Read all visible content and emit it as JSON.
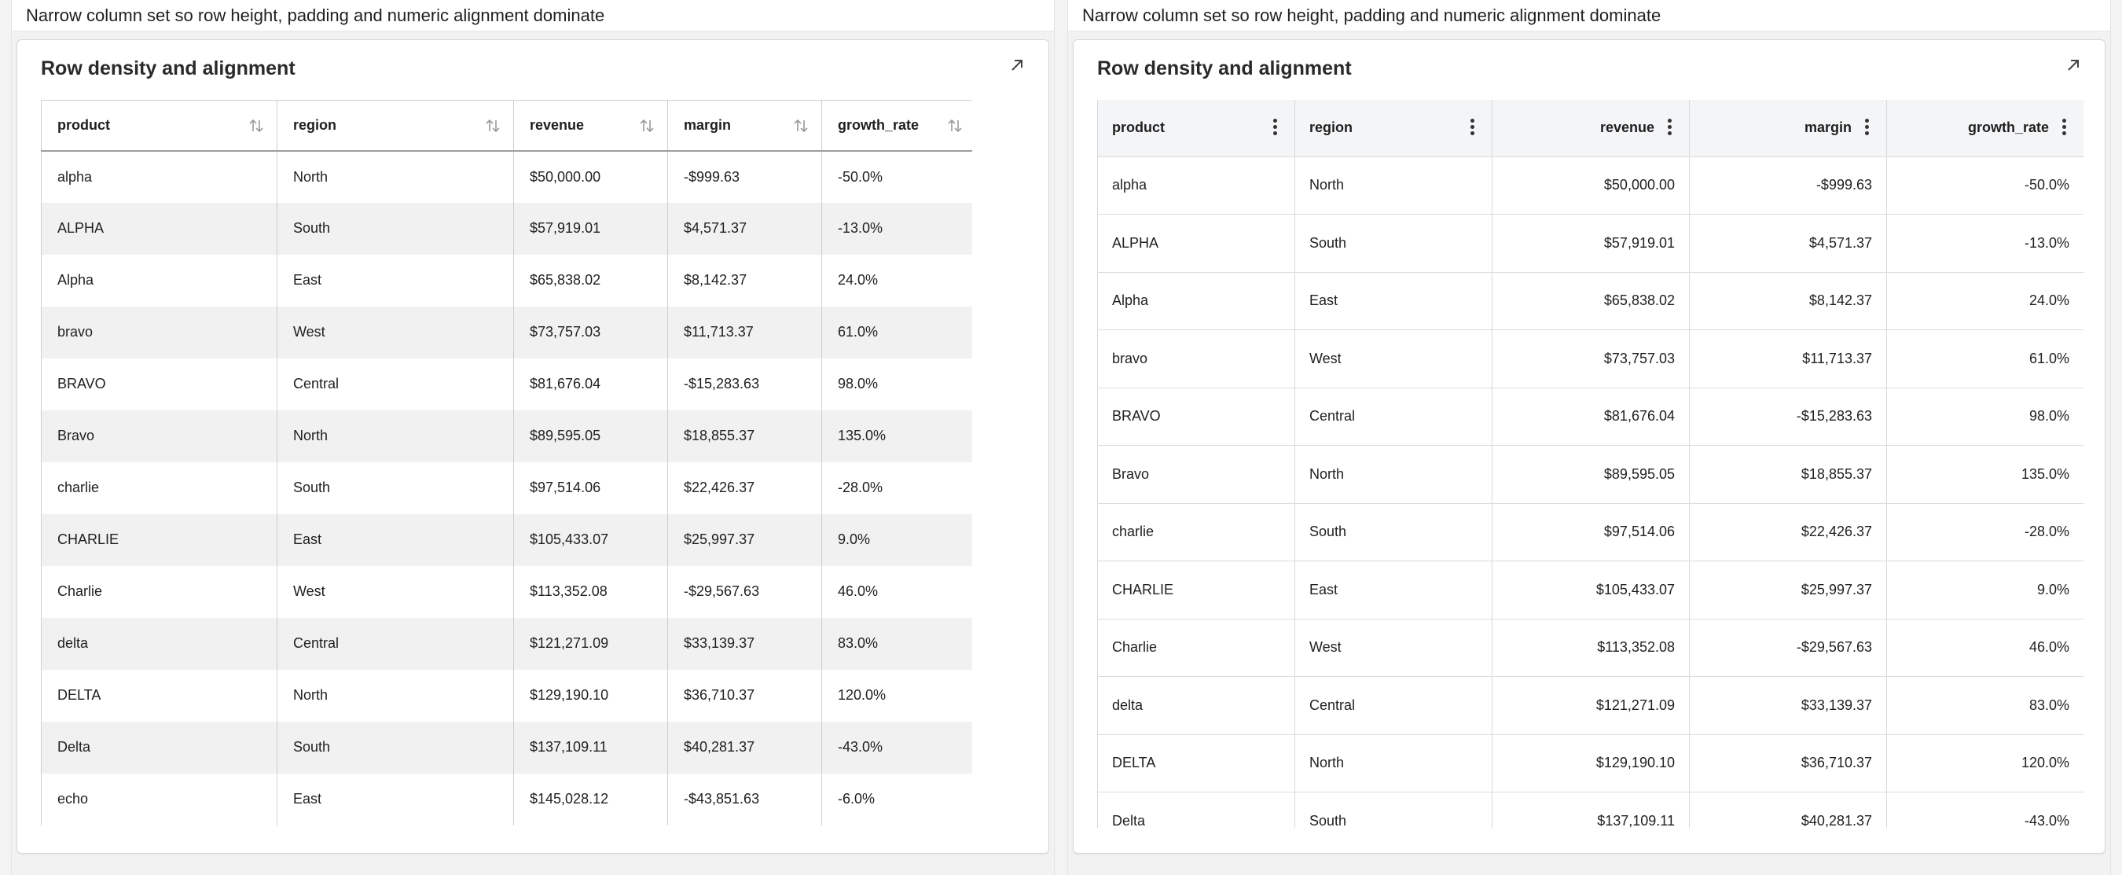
{
  "left_panel": {
    "caption": "Narrow column set so row height, padding and numeric alignment dominate",
    "card_title": "Row density and alignment",
    "columns": [
      "product",
      "region",
      "revenue",
      "margin",
      "growth_rate"
    ]
  },
  "right_panel": {
    "caption": "Narrow column set so row height, padding and numeric alignment dominate",
    "card_title": "Row density and alignment",
    "columns": [
      "product",
      "region",
      "revenue",
      "margin",
      "growth_rate"
    ]
  },
  "rows": [
    {
      "product": "alpha",
      "region": "North",
      "revenue": "$50,000.00",
      "margin": "-$999.63",
      "growth_rate": "-50.0%"
    },
    {
      "product": "ALPHA",
      "region": "South",
      "revenue": "$57,919.01",
      "margin": "$4,571.37",
      "growth_rate": "-13.0%"
    },
    {
      "product": "Alpha",
      "region": "East",
      "revenue": "$65,838.02",
      "margin": "$8,142.37",
      "growth_rate": "24.0%"
    },
    {
      "product": "bravo",
      "region": "West",
      "revenue": "$73,757.03",
      "margin": "$11,713.37",
      "growth_rate": "61.0%"
    },
    {
      "product": "BRAVO",
      "region": "Central",
      "revenue": "$81,676.04",
      "margin": "-$15,283.63",
      "growth_rate": "98.0%"
    },
    {
      "product": "Bravo",
      "region": "North",
      "revenue": "$89,595.05",
      "margin": "$18,855.37",
      "growth_rate": "135.0%"
    },
    {
      "product": "charlie",
      "region": "South",
      "revenue": "$97,514.06",
      "margin": "$22,426.37",
      "growth_rate": "-28.0%"
    },
    {
      "product": "CHARLIE",
      "region": "East",
      "revenue": "$105,433.07",
      "margin": "$25,997.37",
      "growth_rate": "9.0%"
    },
    {
      "product": "Charlie",
      "region": "West",
      "revenue": "$113,352.08",
      "margin": "-$29,567.63",
      "growth_rate": "46.0%"
    },
    {
      "product": "delta",
      "region": "Central",
      "revenue": "$121,271.09",
      "margin": "$33,139.37",
      "growth_rate": "83.0%"
    },
    {
      "product": "DELTA",
      "region": "North",
      "revenue": "$129,190.10",
      "margin": "$36,710.37",
      "growth_rate": "120.0%"
    },
    {
      "product": "Delta",
      "region": "South",
      "revenue": "$137,109.11",
      "margin": "$40,281.37",
      "growth_rate": "-43.0%"
    },
    {
      "product": "echo",
      "region": "East",
      "revenue": "$145,028.12",
      "margin": "-$43,851.63",
      "growth_rate": "-6.0%"
    }
  ],
  "icons": {
    "expand": "expand-arrow-icon",
    "sort": "sort-updown-icon",
    "column_menu": "kebab-menu-icon"
  }
}
